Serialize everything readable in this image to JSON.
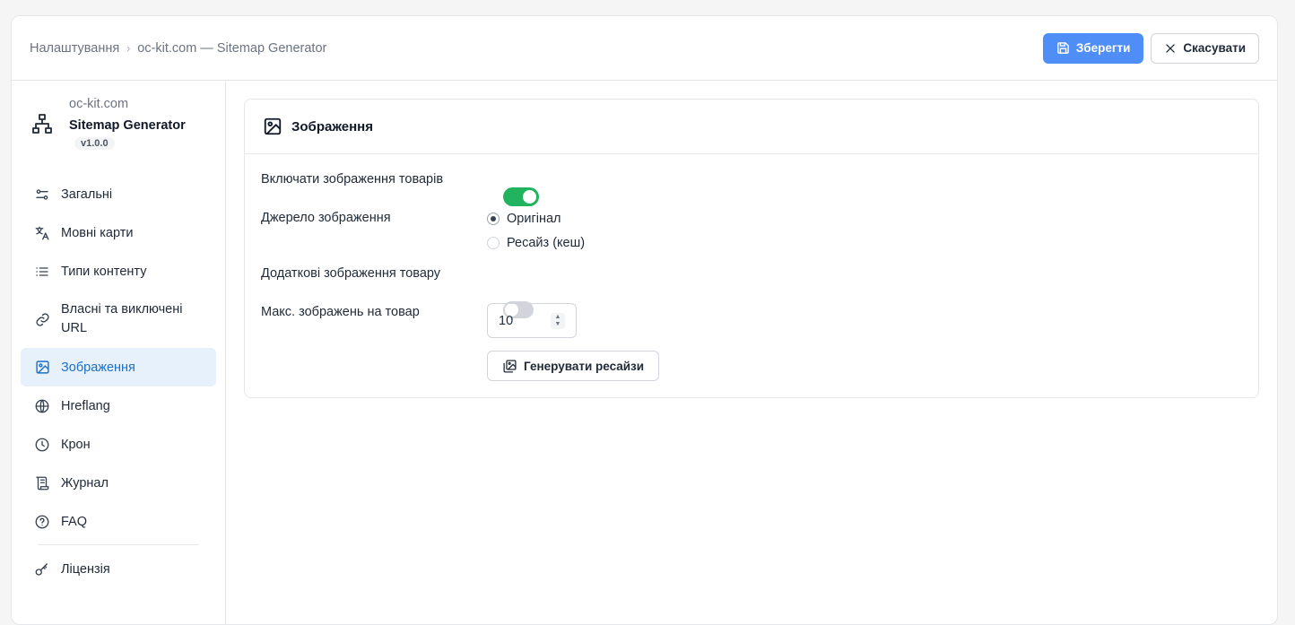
{
  "breadcrumb": {
    "root": "Налаштування",
    "current": "oc-kit.com — Sitemap Generator"
  },
  "toolbar": {
    "save_label": "Зберегти",
    "cancel_label": "Скасувати"
  },
  "brand": {
    "site": "oc-kit.com",
    "name": "Sitemap Generator",
    "version": "v1.0.0",
    "icon": "sitemap-icon"
  },
  "sidebar": {
    "items": [
      {
        "label": "Загальні",
        "icon": "sliders-icon"
      },
      {
        "label": "Мовні карти",
        "icon": "translate-icon"
      },
      {
        "label": "Типи контенту",
        "icon": "list-icon"
      },
      {
        "label": "Власні та виключені URL",
        "icon": "link-icon"
      },
      {
        "label": "Зображення",
        "icon": "image-icon",
        "active": true
      },
      {
        "label": "Hreflang",
        "icon": "globe-icon"
      },
      {
        "label": "Крон",
        "icon": "clock-icon"
      },
      {
        "label": "Журнал",
        "icon": "scroll-icon"
      },
      {
        "label": "FAQ",
        "icon": "help-circle-icon"
      },
      {
        "label": "Ліцензія",
        "icon": "key-icon"
      }
    ]
  },
  "card": {
    "title": "Зображення",
    "include_images": {
      "label": "Включати зображення товарів",
      "value": true
    },
    "image_source": {
      "label": "Джерело зображення",
      "options": [
        "Оригінал",
        "Ресайз (кеш)"
      ],
      "selected": "Оригінал"
    },
    "additional_images": {
      "label": "Додаткові зображення товару",
      "value": false
    },
    "max_images": {
      "label": "Макс. зображень на товар",
      "value": "10"
    },
    "generate_button": "Генерувати ресайзи"
  },
  "colors": {
    "primary": "#4f8ef7",
    "toggle_on": "#22b35e",
    "active_bg": "#e7f1fc",
    "active_text": "#1d6fc4"
  }
}
